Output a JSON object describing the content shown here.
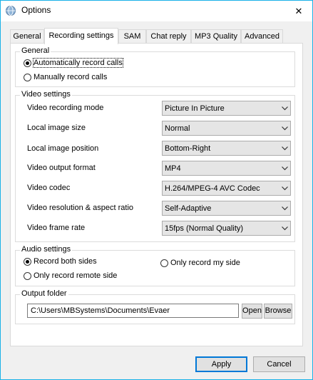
{
  "window": {
    "title": "Options",
    "close_glyph": "✕",
    "icons": {
      "app": "app-globe-icon",
      "close": "close-icon",
      "dropdown": "chevron-down-icon"
    }
  },
  "tabs": [
    {
      "label": "General"
    },
    {
      "label": "Recording settings",
      "selected": true
    },
    {
      "label": "SAM"
    },
    {
      "label": "Chat reply"
    },
    {
      "label": "MP3 Quality"
    },
    {
      "label": "Advanced"
    }
  ],
  "general": {
    "label": "General",
    "options": [
      {
        "label": "Automatically record calls",
        "selected": true
      },
      {
        "label": "Manually record calls",
        "selected": false
      }
    ]
  },
  "video": {
    "label": "Video settings",
    "rows": [
      {
        "label": "Video recording mode",
        "value": "Picture In Picture"
      },
      {
        "label": "Local image size",
        "value": "Normal"
      },
      {
        "label": "Local image position",
        "value": "Bottom-Right"
      },
      {
        "label": "Video output format",
        "value": "MP4"
      },
      {
        "label": "Video codec",
        "value": "H.264/MPEG-4 AVC Codec"
      },
      {
        "label": "Video resolution & aspect ratio",
        "value": "Self-Adaptive"
      },
      {
        "label": "Video frame rate",
        "value": "15fps (Normal Quality)"
      }
    ]
  },
  "audio": {
    "label": "Audio settings",
    "options": [
      {
        "label": "Record both sides",
        "selected": true
      },
      {
        "label": "Only record my side",
        "selected": false
      },
      {
        "label": "Only record remote side",
        "selected": false
      }
    ]
  },
  "output": {
    "label": "Output folder",
    "path": "C:\\Users\\MBSystems\\Documents\\Evaer",
    "open_label": "Open",
    "browse_label": "Browse"
  },
  "footer": {
    "apply_label": "Apply",
    "cancel_label": "Cancel"
  },
  "colors": {
    "accent": "#0078d7",
    "titlebar_border": "#1ab2e8"
  }
}
